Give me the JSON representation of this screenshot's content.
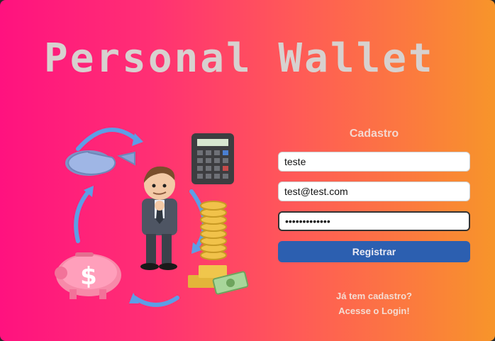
{
  "header": {
    "title": "Personal Wallet"
  },
  "form": {
    "title": "Cadastro",
    "name_value": "teste",
    "email_value": "test@test.com",
    "password_value": "•••••••••••••",
    "submit_label": "Registrar"
  },
  "links": {
    "has_account": "Já tem cadastro?",
    "login": "Acesse o Login!"
  },
  "illustration": {
    "icons": [
      "pie-chart-icon",
      "calculator-icon",
      "coins-money-icon",
      "piggy-bank-icon",
      "thinking-man-icon",
      "cycle-arrow-icon"
    ],
    "currency_symbol": "$"
  },
  "colors": {
    "gradient_start": "#ff127f",
    "gradient_end": "#f7952a",
    "button": "#2c5fb0",
    "title_text": "#d7d1cf"
  }
}
